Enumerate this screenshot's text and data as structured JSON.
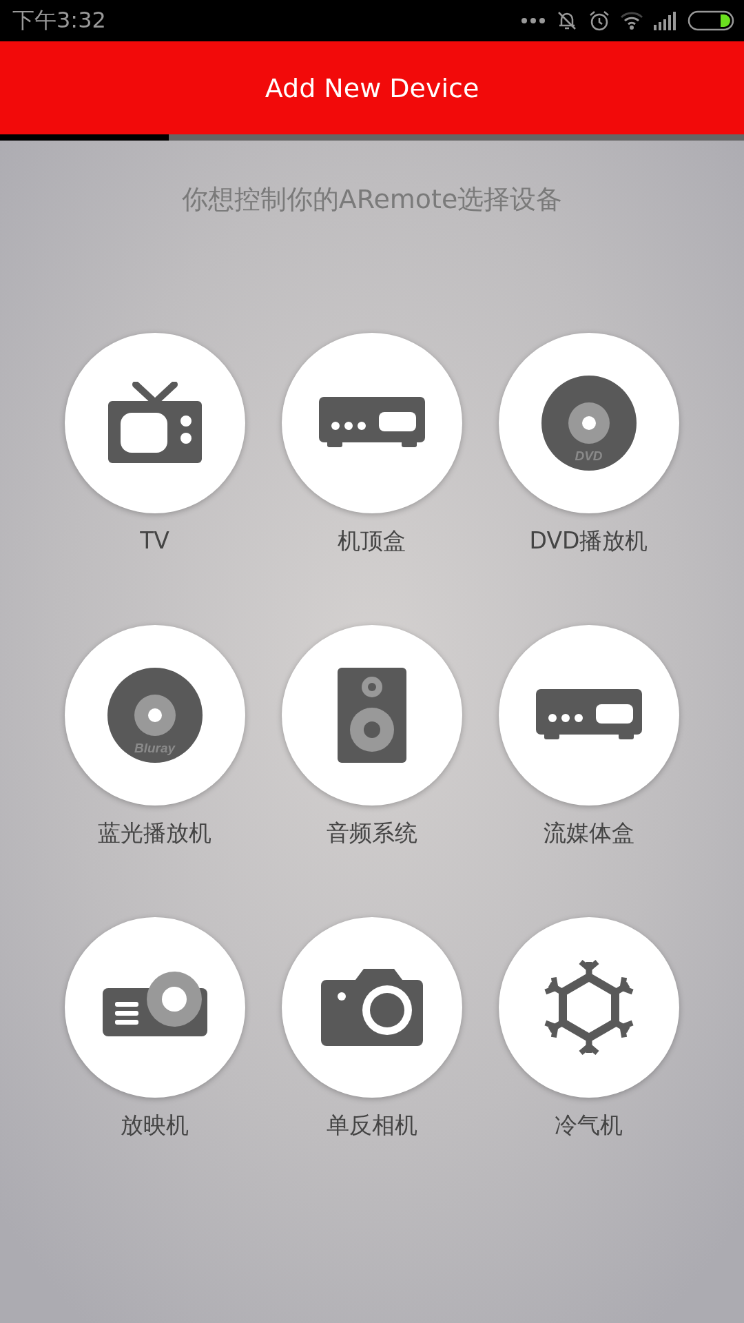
{
  "status_bar": {
    "time": "下午3:32"
  },
  "header": {
    "title": "Add New Device"
  },
  "progress": {
    "level": 0.227
  },
  "subtitle": "你想控制你的ARemote选择设备",
  "devices": [
    {
      "kind": "tv",
      "label": "TV"
    },
    {
      "kind": "set-top-box",
      "label": "机顶盒"
    },
    {
      "kind": "disc",
      "disc_label": "DVD",
      "label": "DVD播放机"
    },
    {
      "kind": "disc",
      "disc_label": "Bluray",
      "label": "蓝光播放机"
    },
    {
      "kind": "speaker",
      "label": "音频系统"
    },
    {
      "kind": "set-top-box",
      "label": "流媒体盒"
    },
    {
      "kind": "projector",
      "label": "放映机"
    },
    {
      "kind": "camera",
      "label": "单反相机"
    },
    {
      "kind": "snowflake",
      "label": "冷气机"
    }
  ]
}
